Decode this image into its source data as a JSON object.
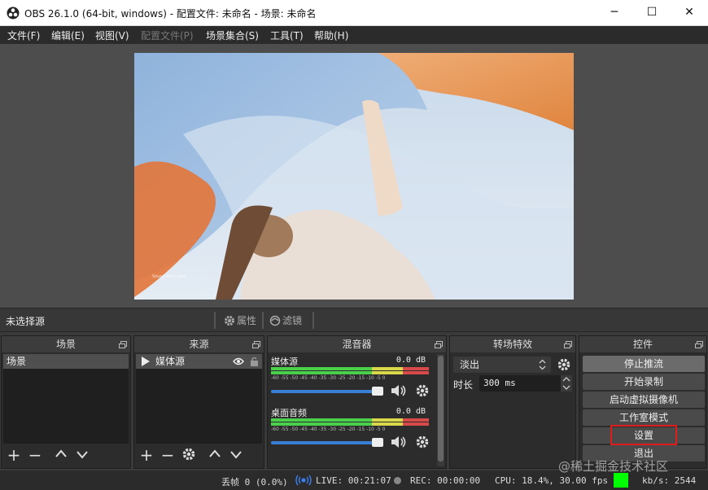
{
  "window": {
    "title": "OBS 26.1.0 (64-bit, windows) - 配置文件: 未命名 - 场景: 未命名",
    "minimize": "─",
    "maximize": "☐",
    "close": "✕"
  },
  "menu": [
    "文件(F)",
    "编辑(E)",
    "视图(V)",
    "配置文件(P)",
    "场景集合(S)",
    "工具(T)",
    "帮助(H)"
  ],
  "preview": {
    "caption": "Sound And Light"
  },
  "source_bar": {
    "label": "未选择源",
    "properties": "属性",
    "filters": "滤镜"
  },
  "scenes": {
    "title": "场景",
    "items": [
      "场景"
    ]
  },
  "sources": {
    "title": "来源",
    "items": [
      "媒体源"
    ]
  },
  "mixer": {
    "title": "混音器",
    "ticks": "-60 -55 -50 -45 -40 -35 -30 -25 -20 -15 -10 -5 0",
    "channels": [
      {
        "name": "媒体源",
        "db": "0.0 dB",
        "volume": 1.0
      },
      {
        "name": "桌面音频",
        "db": "0.0 dB",
        "volume": 1.0
      }
    ]
  },
  "transitions": {
    "title": "转场特效",
    "selected": "淡出",
    "duration_label": "时长",
    "duration": "300 ms"
  },
  "controls": {
    "title": "控件",
    "buttons": [
      "停止推流",
      "开始录制",
      "启动虚拟摄像机",
      "工作室模式",
      "设置",
      "退出"
    ],
    "highlight": "#e11b1b"
  },
  "status": {
    "dropped": "丢帧 0 (0.0%)",
    "live": "LIVE: 00:21:07",
    "rec": "REC: 00:00:00",
    "cpu": "CPU: 18.4%, 30.00 fps",
    "kbps": "kb/s: 2544",
    "indicator_color": "#00ff00"
  },
  "watermark": "@稀土掘金技术社区"
}
